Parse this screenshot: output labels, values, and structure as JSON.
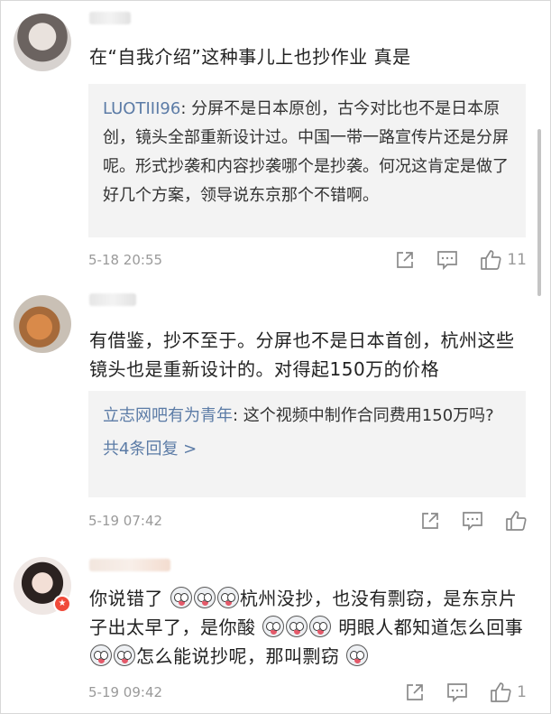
{
  "comments": [
    {
      "text": "在“自我介绍”这种事儿上也抄作业 真是",
      "quote_author": "LUOTIII96",
      "quote_body": ": 分屏不是日本原创，古今对比也不是日本原创，镜头全部重新设计过。中国一带一路宣传片还是分屏呢。形式抄袭和内容抄袭哪个是抄袭。何况这肯定是做了好几个方案，领导说东京那个不错啊。",
      "time": "5-18 20:55",
      "likes": "11"
    },
    {
      "text": "有借鉴，抄不至于。分屏也不是日本首创，杭州这些镜头也是重新设计的。对得起150万的价格",
      "quote_author": "立志网吧有为青年",
      "quote_body": ": 这个视频中制作合同费用150万吗?",
      "reply_link": "共4条回复 >",
      "time": "5-19 07:42"
    },
    {
      "text_segments": [
        "你说错了 ",
        "杭州没抄，也没有剽窃，是东京片子出太早了，是你酸",
        " 明眼人都知道怎么回事",
        "怎么能说抄呢，那叫剽窃"
      ],
      "time": "5-19 09:42",
      "likes": "1"
    }
  ],
  "icons": {
    "share": "share-icon",
    "reply": "reply-icon",
    "like": "thumbs-up-icon",
    "emoji": "laugh-cry-emoji-icon"
  },
  "colors": {
    "link": "#5b7ba6",
    "time": "#9a9a9a",
    "quote_bg": "#f3f3f3"
  }
}
